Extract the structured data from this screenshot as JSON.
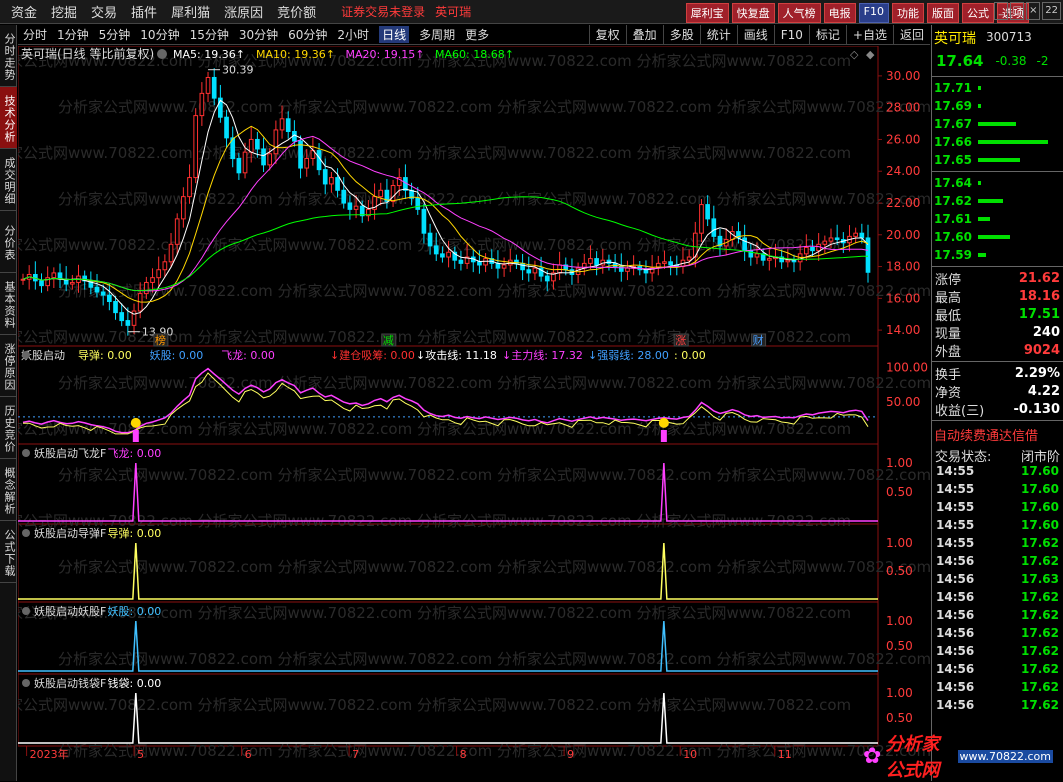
{
  "top_menu": [
    "资金",
    "挖掘",
    "交易",
    "插件",
    "犀利猫",
    "涨原因",
    "竞价额"
  ],
  "top_warning": "证券交易未登录",
  "top_stock": "英可瑞",
  "top_buttons": [
    {
      "label": "犀利宝",
      "style": "r"
    },
    {
      "label": "快复盘",
      "style": "r"
    },
    {
      "label": "人气榜",
      "style": "r"
    },
    {
      "label": "电报",
      "style": "r"
    },
    {
      "label": "F10",
      "style": "b"
    },
    {
      "label": "功能",
      "style": "r"
    },
    {
      "label": "版面",
      "style": "r"
    },
    {
      "label": "公式",
      "style": "r"
    },
    {
      "label": "选项",
      "style": "r"
    }
  ],
  "window_controls": [
    "_",
    "□",
    "×"
  ],
  "clock": "22",
  "side_tabs": [
    "分时走势",
    "技术分析",
    "成交明细",
    "分价表",
    "基本资料",
    "涨停原因",
    "历史竞价",
    "概念解析",
    "公式下载"
  ],
  "active_side_tab": 1,
  "periods": [
    "分时",
    "1分钟",
    "5分钟",
    "10分钟",
    "15分钟",
    "30分钟",
    "60分钟",
    "2小时",
    "日线",
    "多周期",
    "更多"
  ],
  "active_period": 8,
  "tool_buttons": [
    "复权",
    "叠加",
    "多股",
    "统计",
    "画线",
    "F10",
    "标记",
    "+自选",
    "返回"
  ],
  "main_title": "英可瑞(日线 等比前复权)",
  "ma": [
    {
      "label": "MA5: 19.36",
      "color": "#ffffff"
    },
    {
      "label": "MA10: 19.36",
      "color": "#ffd700"
    },
    {
      "label": "MA20: 19.15",
      "color": "#ff40ff"
    },
    {
      "label": "MA60: 18.68",
      "color": "#00ff00"
    }
  ],
  "price_axis": [
    "30.00",
    "28.00",
    "26.00",
    "24.00",
    "22.00",
    "20.00",
    "18.00",
    "16.00",
    "14.00"
  ],
  "price_high_label": "30.39",
  "price_low_label": "13.90",
  "event_marks": [
    {
      "label": "榜",
      "color": "#ff9900"
    },
    {
      "label": "减",
      "color": "#00e000"
    },
    {
      "label": "涨",
      "color": "#ff4040"
    },
    {
      "label": "财",
      "color": "#4aa0ff"
    }
  ],
  "ind1": {
    "name": "妖股启动",
    "items": [
      {
        "label": "导弹: 0.00",
        "color": "#ffff60"
      },
      {
        "label": "妖股: 0.00",
        "color": "#40a0ff"
      },
      {
        "label": "飞龙: 0.00",
        "color": "#ff40ff"
      },
      {
        "label": "建仓吸筹: 0.00",
        "color": "#ff3030"
      },
      {
        "label": "攻击线: 11.18",
        "color": "#ffffff"
      },
      {
        "label": "主力线: 17.32",
        "color": "#ff40ff"
      },
      {
        "label": "强弱线: 28.00",
        "color": "#40a0ff"
      },
      {
        "label": ": 0.00",
        "color": "#ffff60"
      }
    ],
    "axis": [
      "100.00",
      "50.00"
    ]
  },
  "sub_panels": [
    {
      "name": "妖股启动飞龙F",
      "item": "飞龙: 0.00",
      "color": "#ff40ff",
      "axis": [
        "1.00",
        "0.50"
      ]
    },
    {
      "name": "妖股启动导弹F",
      "item": "导弹: 0.00",
      "color": "#ffff60",
      "axis": [
        "1.00",
        "0.50"
      ]
    },
    {
      "name": "妖股启动妖股F",
      "item": "妖股: 0.00",
      "color": "#40c0ff",
      "axis": [
        "1.00",
        "0.50"
      ]
    },
    {
      "name": "妖股启动钱袋F",
      "item": "钱袋: 0.00",
      "color": "#ffffff",
      "axis": [
        "1.00",
        "0.50"
      ]
    }
  ],
  "date_axis": [
    "2023年",
    "5",
    "6",
    "7",
    "8",
    "9",
    "10",
    "11"
  ],
  "right_panel": {
    "name": "英可瑞",
    "code": "300713",
    "price": "17.64",
    "change": "-0.38",
    "change_pct": "-2",
    "sell_orders": [
      "17.71",
      "17.69",
      "17.67",
      "17.66",
      "17.65"
    ],
    "sell_sizes": [
      3,
      3,
      38,
      70,
      42
    ],
    "buy_orders": [
      "17.64",
      "17.62",
      "17.61",
      "17.60",
      "17.59"
    ],
    "buy_sizes": [
      3,
      25,
      12,
      32,
      8
    ],
    "stats1": [
      {
        "k": "涨停",
        "v": "21.62",
        "c": "#ff3b3b"
      },
      {
        "k": "最高",
        "v": "18.16",
        "c": "#ff3b3b"
      },
      {
        "k": "最低",
        "v": "17.51",
        "c": "#00e000"
      },
      {
        "k": "现量",
        "v": "240",
        "c": "#ffffff"
      },
      {
        "k": "外盘",
        "v": "9024",
        "c": "#ff3b3b"
      }
    ],
    "stats2": [
      {
        "k": "换手",
        "v": "2.29%",
        "c": "#ffffff"
      },
      {
        "k": "净资",
        "v": "4.22",
        "c": "#ffffff"
      },
      {
        "k": "收益(三)",
        "v": "-0.130",
        "c": "#ffffff"
      }
    ],
    "ticker": "自动续费通达信借",
    "trade_status_label": "交易状态:",
    "trade_status": "闭市阶",
    "ticks": [
      [
        "14:55",
        "17.60"
      ],
      [
        "14:55",
        "17.60"
      ],
      [
        "14:55",
        "17.60"
      ],
      [
        "14:55",
        "17.60"
      ],
      [
        "14:55",
        "17.62"
      ],
      [
        "14:56",
        "17.62"
      ],
      [
        "14:56",
        "17.63"
      ],
      [
        "14:56",
        "17.62"
      ],
      [
        "14:56",
        "17.62"
      ],
      [
        "14:56",
        "17.62"
      ],
      [
        "14:56",
        "17.62"
      ],
      [
        "14:56",
        "17.62"
      ],
      [
        "14:56",
        "17.62"
      ],
      [
        "14:56",
        "17.62"
      ]
    ]
  },
  "logo_text": "分析家公式网",
  "logo_url": "www.70822.com",
  "watermark": "分析家公式网www.70822.com",
  "chart_data": {
    "type": "candlestick",
    "title": "英可瑞(日线 等比前复权)",
    "ylim": [
      13,
      31
    ],
    "y_ticks": [
      14,
      16,
      18,
      20,
      22,
      24,
      26,
      28,
      30
    ],
    "highest": 30.39,
    "lowest": 13.9,
    "close_series": [
      17.2,
      17.5,
      17.1,
      16.8,
      17.3,
      17.6,
      17.2,
      16.9,
      17.0,
      17.4,
      17.1,
      16.7,
      16.4,
      16.2,
      15.8,
      15.1,
      14.6,
      14.3,
      15.2,
      16.3,
      17.0,
      17.3,
      17.8,
      18.3,
      19.4,
      21.0,
      22.4,
      23.6,
      27.5,
      28.9,
      29.9,
      28.6,
      27.4,
      26.1,
      24.8,
      23.9,
      25.2,
      26.0,
      25.4,
      24.4,
      25.1,
      26.6,
      27.3,
      26.5,
      25.9,
      24.2,
      24.8,
      25.3,
      24.1,
      23.2,
      23.6,
      22.8,
      22.0,
      21.6,
      21.8,
      21.2,
      21.6,
      22.4,
      22.8,
      22.1,
      23.1,
      23.6,
      22.8,
      22.3,
      21.6,
      20.1,
      19.3,
      18.8,
      18.6,
      18.9,
      18.4,
      18.2,
      18.6,
      18.3,
      18.1,
      18.5,
      18.2,
      17.9,
      18.1,
      18.4,
      18.2,
      17.8,
      17.6,
      17.9,
      17.4,
      17.1,
      17.6,
      18.1,
      17.8,
      17.5,
      17.9,
      18.2,
      18.5,
      18.1,
      18.4,
      18.2,
      18.0,
      17.7,
      17.9,
      18.0,
      17.8,
      17.6,
      17.9,
      18.2,
      18.3,
      18.1,
      18.0,
      18.4,
      18.6,
      20.1,
      21.9,
      21.0,
      19.9,
      19.3,
      19.7,
      20.2,
      19.8,
      19.0,
      18.6,
      18.8,
      18.4,
      18.5,
      18.6,
      18.3,
      18.4,
      18.3,
      18.8,
      19.2,
      19.0,
      19.4,
      19.6,
      19.8,
      19.7,
      19.5,
      19.9,
      20.1,
      19.8,
      17.64
    ],
    "ma_last": {
      "MA5": 19.36,
      "MA10": 19.36,
      "MA20": 19.15,
      "MA60": 18.68
    },
    "signal_positions": [
      0.137,
      0.751
    ],
    "ind1_ylim": [
      0,
      120
    ]
  }
}
